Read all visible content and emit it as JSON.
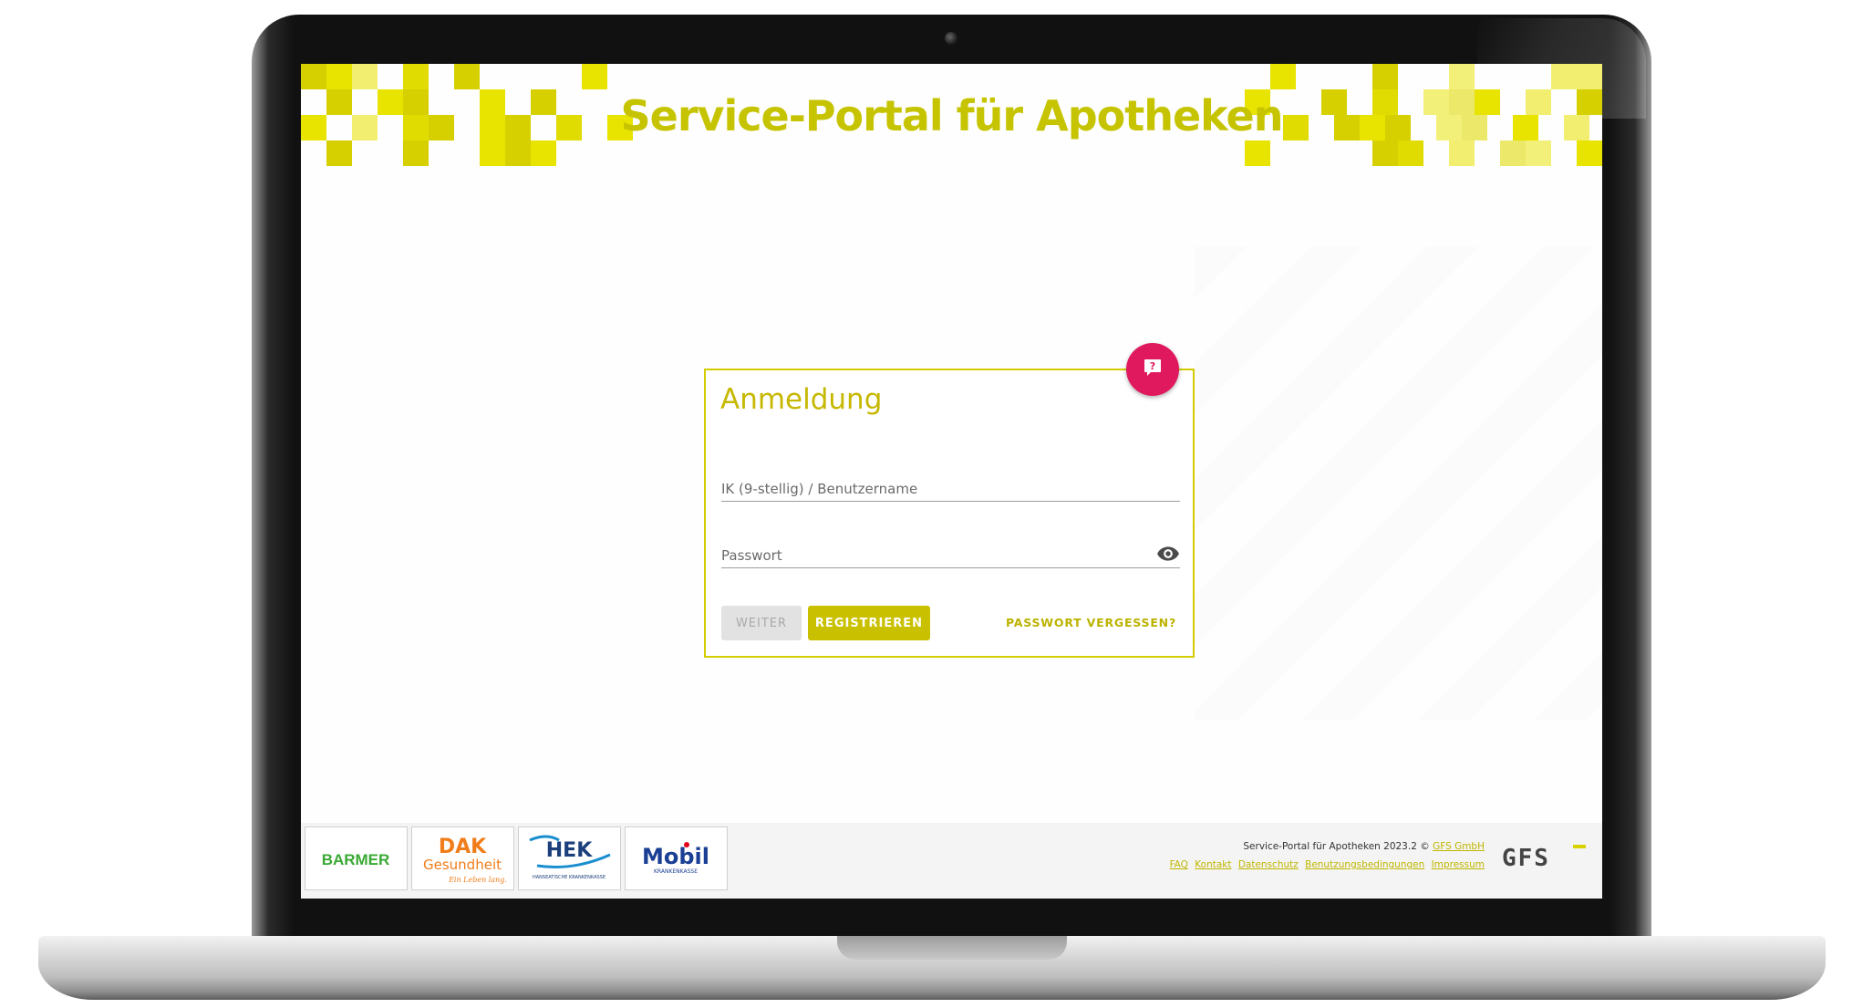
{
  "header": {
    "title": "Service-Portal für Apotheken"
  },
  "login": {
    "title": "Anmeldung",
    "username_placeholder": "IK (9-stellig) / Benutzername",
    "username_value": "",
    "password_placeholder": "Passwort",
    "password_value": "",
    "weiter_label": "WEITER",
    "register_label": "REGISTRIEREN",
    "forgot_label": "PASSWORT VERGESSEN?"
  },
  "partners": {
    "barmer": "BARMER",
    "dak_1": "DAK",
    "dak_2": "Gesundheit",
    "dak_3": "Ein Leben lang.",
    "hek_1": "HEK",
    "hek_2": "HANSEATISCHE KRANKENKASSE",
    "mobil_1": "Mobil",
    "mobil_2": "KRANKENKASSE"
  },
  "footer": {
    "copyright": "Service-Portal für Apotheken 2023.2 ©",
    "company_link": "GFS GmbH",
    "links": [
      "FAQ",
      "Kontakt",
      "Datenschutz",
      "Benutzungsbedingungen",
      "Impressum"
    ],
    "brand": "GFS"
  },
  "colors": {
    "brand_yellow": "#c6c400",
    "help_pink": "#e0195f"
  },
  "icons": {
    "help": "help-chat-icon",
    "password_toggle": "eye-icon"
  }
}
